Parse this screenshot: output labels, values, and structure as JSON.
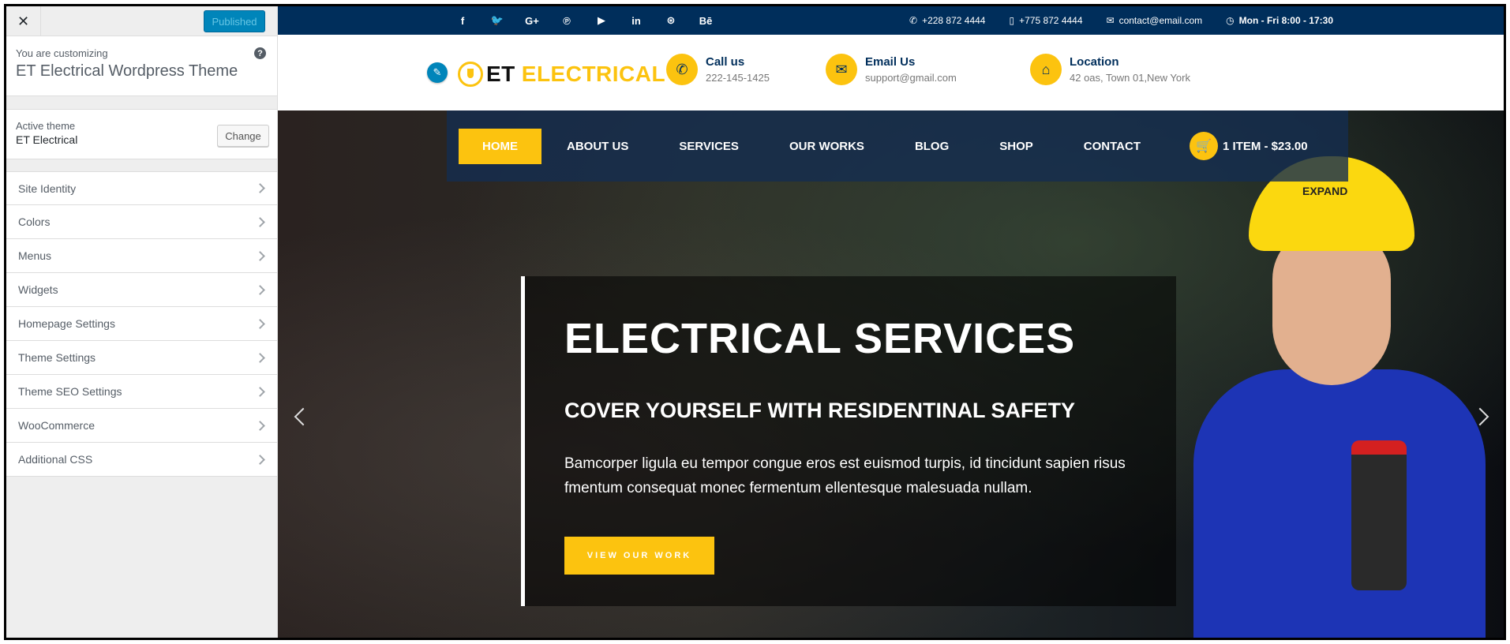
{
  "customizer": {
    "close_label": "✕",
    "publish_label": "Published",
    "customizing_label": "You are customizing",
    "site_title": "ET Electrical Wordpress Theme",
    "help_icon": "?",
    "active_theme_label": "Active theme",
    "active_theme_name": "ET Electrical",
    "change_label": "Change",
    "sections": [
      {
        "label": "Site Identity"
      },
      {
        "label": "Colors"
      },
      {
        "label": "Menus"
      },
      {
        "label": "Widgets"
      },
      {
        "label": "Homepage Settings"
      },
      {
        "label": "Theme Settings"
      },
      {
        "label": "Theme SEO Settings"
      },
      {
        "label": "WooCommerce"
      },
      {
        "label": "Additional CSS"
      }
    ]
  },
  "site": {
    "social_icons": [
      {
        "name": "facebook-icon",
        "glyph": "f"
      },
      {
        "name": "twitter-icon",
        "glyph": "🐦"
      },
      {
        "name": "google-plus-icon",
        "glyph": "G+"
      },
      {
        "name": "pinterest-icon",
        "glyph": "℗"
      },
      {
        "name": "youtube-icon",
        "glyph": "▶"
      },
      {
        "name": "linkedin-icon",
        "glyph": "in"
      },
      {
        "name": "dribbble-icon",
        "glyph": "⊛"
      },
      {
        "name": "behance-icon",
        "glyph": "Bē"
      }
    ],
    "topbar": {
      "phone1": "+228 872 4444",
      "phone2": "+775 872 4444",
      "email": "contact@email.com",
      "hours": "Mon - Fri 8:00 - 17:30"
    },
    "logo": {
      "part1": "ET",
      "part2": "ELECTRICAL"
    },
    "header_info": [
      {
        "title": "Call us",
        "value": "222-145-1425",
        "icon": "✆"
      },
      {
        "title": "Email Us",
        "value": "support@gmail.com",
        "icon": "✉"
      },
      {
        "title": "Location",
        "value": "42 oas, Town 01,New York",
        "icon": "⌂"
      }
    ],
    "nav": [
      {
        "label": "HOME",
        "active": true
      },
      {
        "label": "ABOUT US"
      },
      {
        "label": "SERVICES"
      },
      {
        "label": "OUR WORKS"
      },
      {
        "label": "BLOG"
      },
      {
        "label": "SHOP"
      },
      {
        "label": "CONTACT"
      }
    ],
    "cart_label": "1 ITEM - $23.00",
    "hero": {
      "title": "ELECTRICAL SERVICES",
      "subtitle": "COVER YOURSELF WITH RESIDENTINAL SAFETY",
      "text": "Bamcorper ligula eu tempor congue eros est euismod turpis, id tincidunt sapien risus fmentum consequat monec fermentum ellentesque malesuada nullam.",
      "button_label": "VIEW OUR WORK",
      "helmet_brand": "EXPAND"
    },
    "colors": {
      "accent": "#fcc30f",
      "navy": "#002e5b",
      "publish_blue": "#0085ba"
    }
  }
}
